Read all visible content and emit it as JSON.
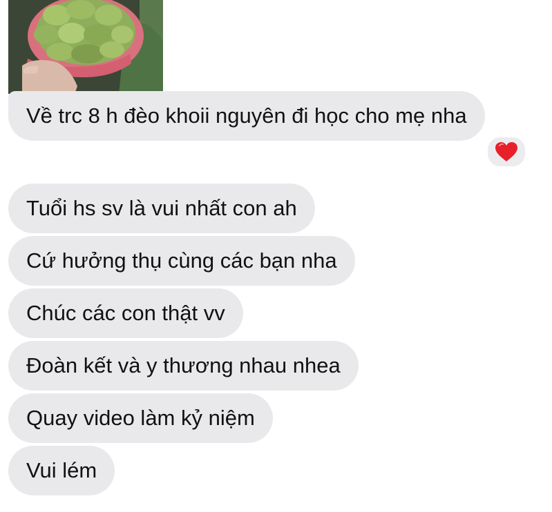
{
  "conversation": {
    "attachment": {
      "type": "photo",
      "description_icon": "photo-thumbnail"
    },
    "first_message": {
      "text": "Về trc 8 h đèo khoii nguyên đi học cho mẹ nha",
      "reaction_icon": "heart-icon",
      "reaction_color": "#e8202a"
    },
    "messages": [
      {
        "text": "Tuổi hs sv là vui nhất con ah"
      },
      {
        "text": "Cứ hưởng thụ cùng các bạn nha"
      },
      {
        "text": "Chúc các con thật vv"
      },
      {
        "text": "Đoàn kết và y thương nhau nhea"
      },
      {
        "text": "Quay video làm kỷ niệm"
      },
      {
        "text": "Vui lém"
      }
    ]
  },
  "colors": {
    "bubble_background": "#e9e9eb",
    "text": "#111111",
    "page_background": "#ffffff"
  }
}
